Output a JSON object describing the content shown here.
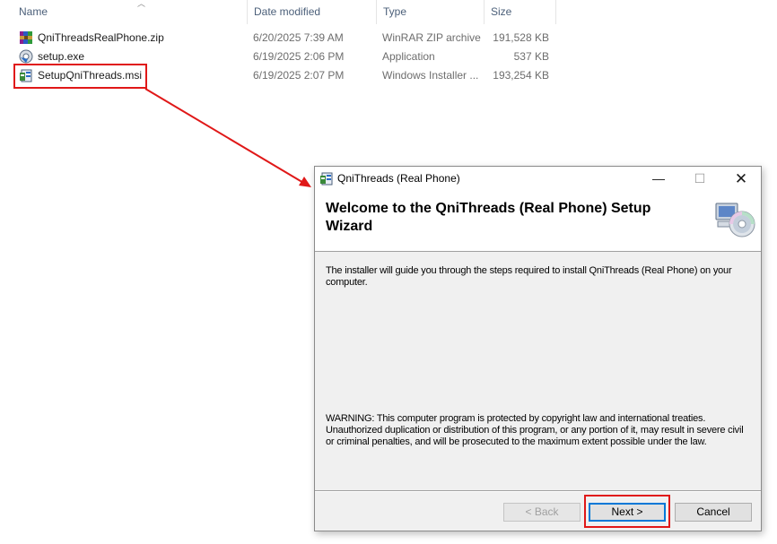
{
  "explorer": {
    "columns": {
      "name": "Name",
      "date": "Date modified",
      "type": "Type",
      "size": "Size"
    },
    "files": [
      {
        "name": "QniThreadsRealPhone.zip",
        "date": "6/20/2025 7:39 AM",
        "type": "WinRAR ZIP archive",
        "size": "191,528 KB",
        "icon": "winrar-archive-icon"
      },
      {
        "name": "setup.exe",
        "date": "6/19/2025 2:06 PM",
        "type": "Application",
        "size": "537 KB",
        "icon": "setup-exe-icon"
      },
      {
        "name": "SetupQniThreads.msi",
        "date": "6/19/2025 2:07 PM",
        "type": "Windows Installer ...",
        "size": "193,254 KB",
        "icon": "msi-installer-icon"
      }
    ]
  },
  "dialog": {
    "title": "QniThreads (Real Phone)",
    "heading": "Welcome to the QniThreads (Real Phone) Setup Wizard",
    "intro": "The installer will guide you through the steps required to install QniThreads (Real Phone) on your computer.",
    "warning": "WARNING: This computer program is protected by copyright law and international treaties. Unauthorized duplication or distribution of this program, or any portion of it, may result in severe civil or criminal penalties, and will be prosecuted to the maximum extent possible under the law.",
    "buttons": {
      "back": "< Back",
      "next": "Next >",
      "cancel": "Cancel"
    },
    "window_controls": {
      "minimize": "—",
      "maximize": "☐",
      "close": "✕"
    }
  },
  "colors": {
    "annotation": "#e01818",
    "focus": "#0078d7"
  }
}
